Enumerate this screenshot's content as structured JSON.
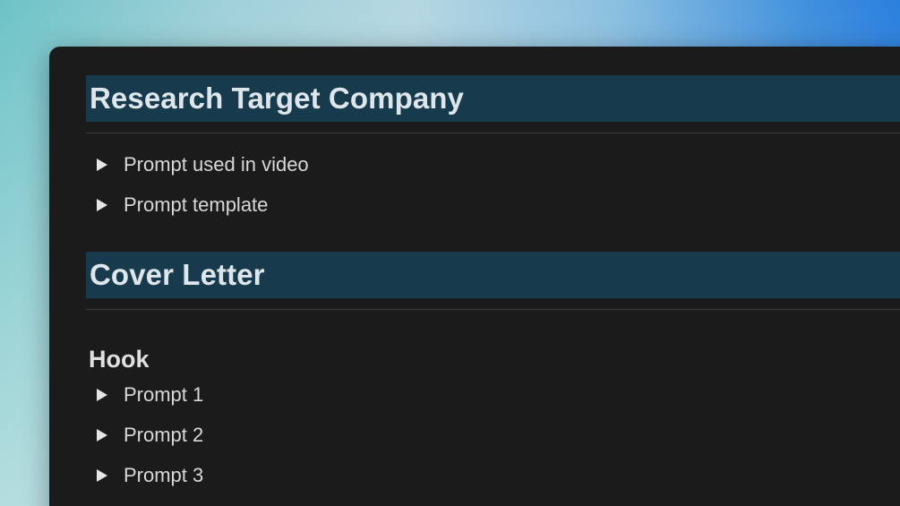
{
  "sections": [
    {
      "heading": "Research Target Company",
      "toggles": [
        {
          "label": "Prompt used in video"
        },
        {
          "label": "Prompt template"
        }
      ]
    },
    {
      "heading": "Cover Letter",
      "subheading": "Hook",
      "toggles": [
        {
          "label": "Prompt 1"
        },
        {
          "label": "Prompt 2"
        },
        {
          "label": "Prompt 3"
        }
      ]
    }
  ],
  "colors": {
    "window_bg": "#1b1b1b",
    "heading_highlight": "#183a4d",
    "text": "#d8d8d8"
  },
  "icons": {
    "toggle": "triangle-right-icon"
  }
}
